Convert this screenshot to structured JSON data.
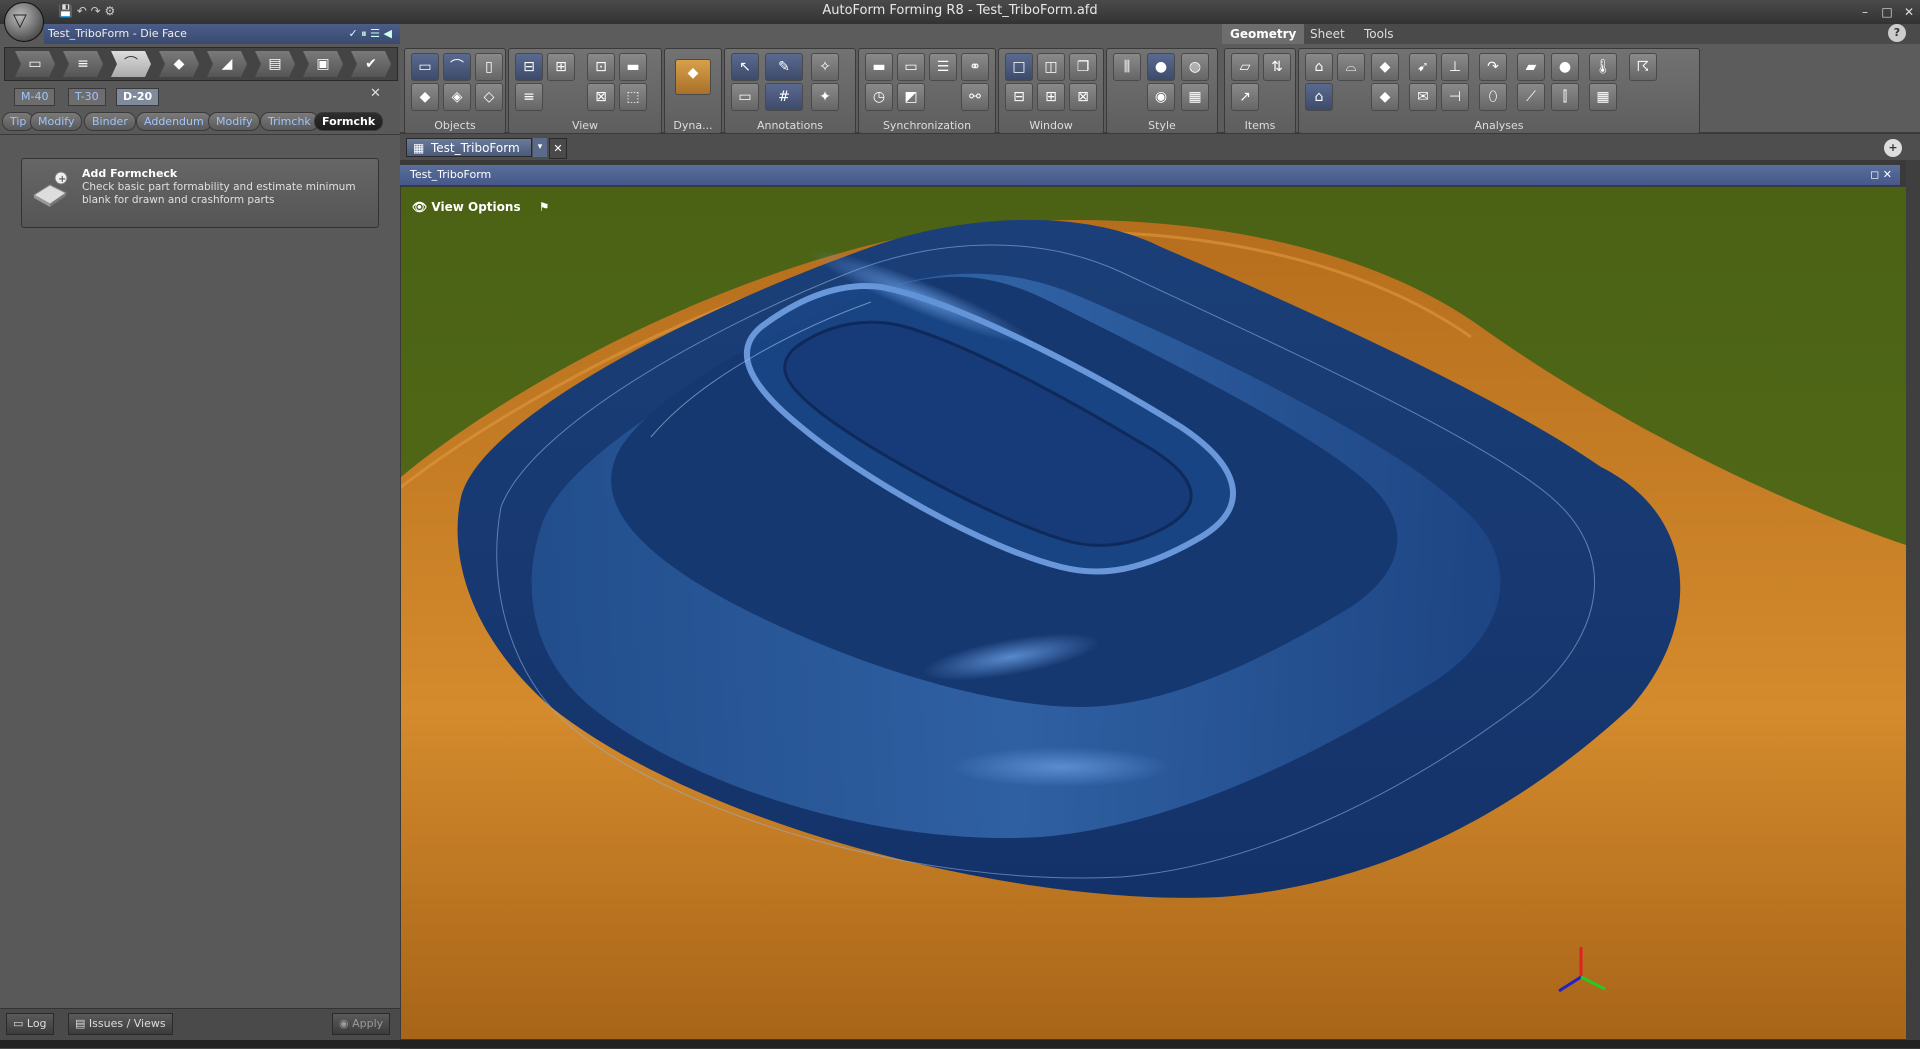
{
  "window": {
    "title": "AutoForm Forming R8 - Test_TriboForm.afd",
    "min": "–",
    "max": "□",
    "close": "✕",
    "help": "?"
  },
  "left_panel": {
    "doc_title": "Test_TriboForm - Die Face",
    "die_tabs": [
      "M-40",
      "T-30",
      "D-20"
    ],
    "die_tab_active": "D-20",
    "tool_pills": [
      "Tip",
      "Modify",
      "Binder",
      "Addendum",
      "Modify",
      "Trimchk",
      "Formchk"
    ],
    "tool_pill_active": "Formchk",
    "formcheck": {
      "title": "Add Formcheck",
      "description": "Check basic part formability and estimate minimum blank for drawn and crashform parts"
    },
    "bottom": {
      "log": "Log",
      "issues": "Issues / Views",
      "apply": "Apply"
    }
  },
  "ribbon": {
    "tabs": [
      "Geometry",
      "Sheet",
      "Tools"
    ],
    "active_tab": "Geometry",
    "groups": [
      "Objects",
      "View",
      "Dyna...",
      "Annotations",
      "Synchronization",
      "Window",
      "Style",
      "Items",
      "Analyses"
    ]
  },
  "document_tab": {
    "label": "Test_TriboForm"
  },
  "viewport": {
    "title": "Test_TriboForm",
    "view_options": "View Options",
    "colors": {
      "background": "#4d6316",
      "part": "#163870",
      "binder": "#c77e22"
    }
  }
}
